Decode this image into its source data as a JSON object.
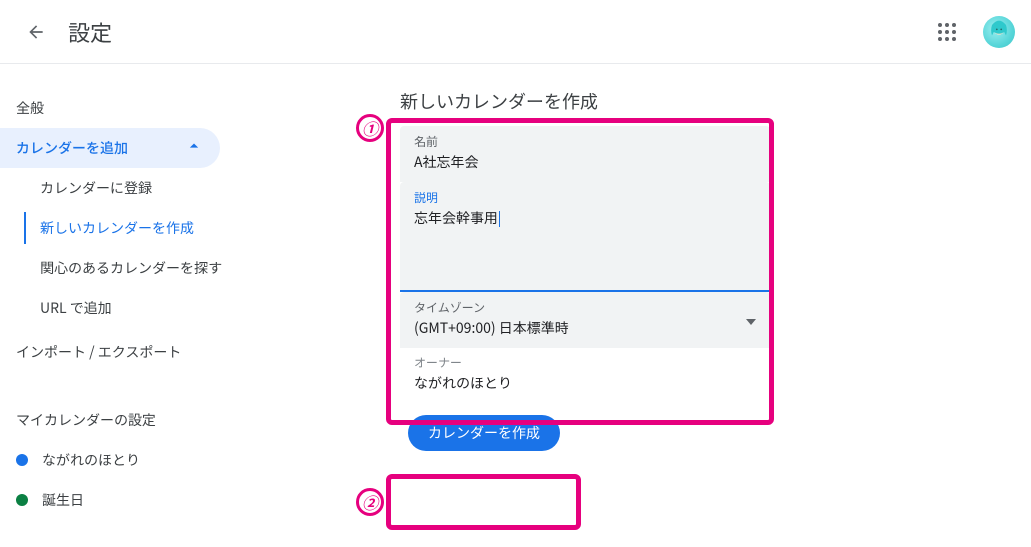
{
  "header": {
    "title": "設定"
  },
  "sidebar": {
    "general": "全般",
    "addCalendar": "カレンダーを追加",
    "sub": {
      "subscribe": "カレンダーに登録",
      "createNew": "新しいカレンダーを作成",
      "browse": "関心のあるカレンダーを探す",
      "urlAdd": "URL で追加"
    },
    "importExport": "インポート / エクスポート",
    "myCalSection": "マイカレンダーの設定",
    "calendars": {
      "primary": "ながれのほとり",
      "birthdays": "誕生日"
    }
  },
  "form": {
    "heading": "新しいカレンダーを作成",
    "nameLabel": "名前",
    "nameValue": "A社忘年会",
    "descLabel": "説明",
    "descValue": "忘年会幹事用",
    "tzLabel": "タイムゾーン",
    "tzValue": "(GMT+09:00) 日本標準時",
    "ownerLabel": "オーナー",
    "ownerValue": "ながれのほとり",
    "createBtn": "カレンダーを作成"
  },
  "annotations": {
    "badge1": "①",
    "badge2": "②"
  }
}
